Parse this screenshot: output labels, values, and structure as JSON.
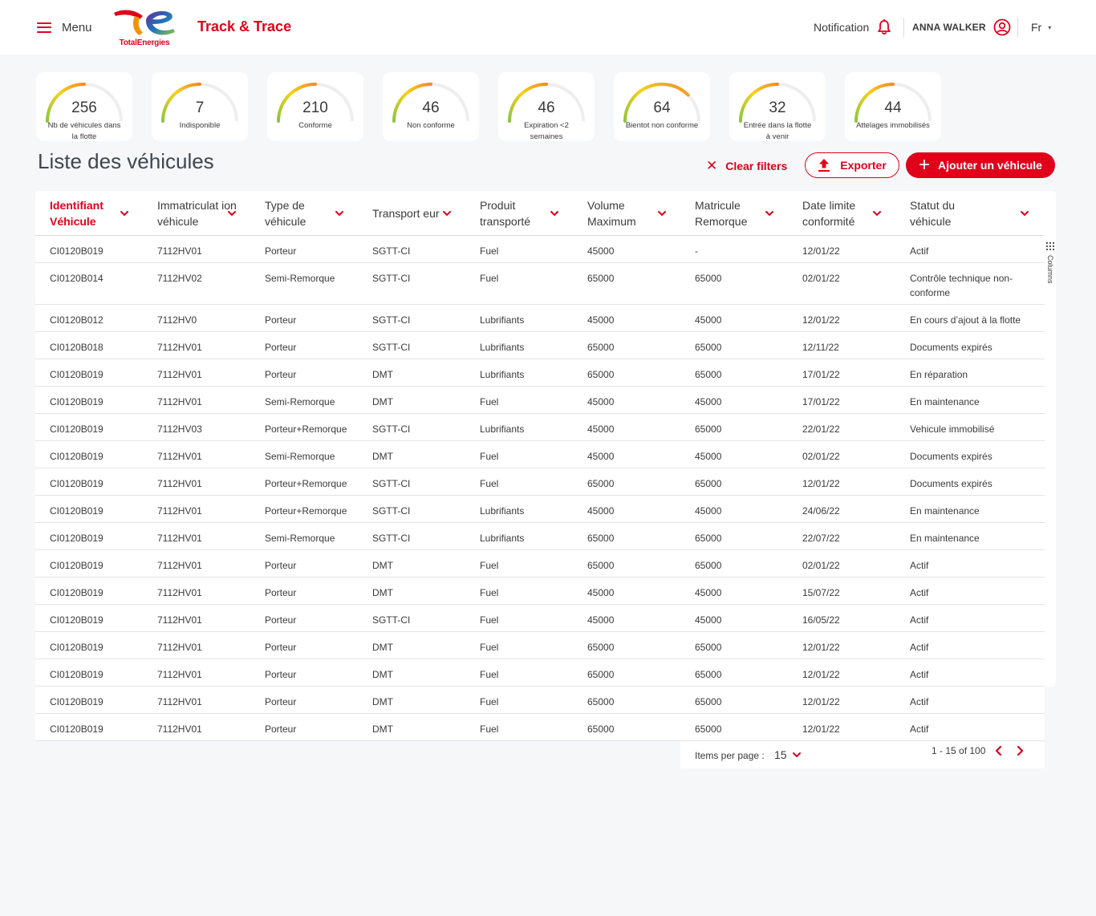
{
  "header": {
    "menu_label": "Menu",
    "logo_text": "TotalEnergies",
    "app_title": "Track & Trace",
    "notification_label": "Notification",
    "user_name": "ANNA WALKER",
    "language": "Fr"
  },
  "colors": {
    "accent": "#e0001a",
    "gauge_start": "#8cc63f",
    "gauge_mid": "#f7d117",
    "gauge_end": "#f28c28"
  },
  "kpis": [
    {
      "value": "256",
      "label": "Nb de véhicules dans la flotte",
      "level": 0.5
    },
    {
      "value": "7",
      "label": "Indisponible",
      "level": 0.5
    },
    {
      "value": "210",
      "label": "Conforme",
      "level": 0.5
    },
    {
      "value": "46",
      "label": "Non conforme",
      "level": 0.5
    },
    {
      "value": "46",
      "label": "Expiration <2 semaines",
      "level": 0.5
    },
    {
      "value": "64",
      "label": "Bientot non conforme",
      "level": 0.75
    },
    {
      "value": "32",
      "label": "Entrée dans la flotte à venir",
      "level": 0.5
    },
    {
      "value": "44",
      "label": "Attelages immobilisés",
      "level": 0.5
    }
  ],
  "page": {
    "title": "Liste des véhicules",
    "clear_filters": "Clear filters",
    "export_label": "Exporter",
    "add_label": "Ajouter un véhicule"
  },
  "table": {
    "columns": [
      "Identifiant Véhicule",
      "Immatriculat ion véhicule",
      "Type de véhicule",
      "Transport eur",
      "Produit transporté",
      "Volume Maximum",
      "Matricule Remorque",
      "Date limite conformité",
      "Statut du véhicule"
    ],
    "active_column": 0,
    "columns_tab_label": "Columns",
    "rows": [
      [
        "CI0120B019",
        "7112HV01",
        "Porteur",
        "SGTT-CI",
        "Fuel",
        "45000",
        "-",
        "12/01/22",
        "Actif"
      ],
      [
        "CI0120B014",
        "7112HV02",
        "Semi-Remorque",
        "SGTT-CI",
        "Fuel",
        "65000",
        "65000",
        "02/01/22",
        "Contrôle technique non-conforme"
      ],
      [
        "CI0120B012",
        "7112HV0",
        "Porteur",
        "SGTT-CI",
        "Lubrifiants",
        "45000",
        "45000",
        "12/01/22",
        "En cours d’ajout à la flotte"
      ],
      [
        "CI0120B018",
        "7112HV01",
        "Porteur",
        "SGTT-CI",
        "Lubrifiants",
        "65000",
        "65000",
        "12/11/22",
        "Documents expirés"
      ],
      [
        "CI0120B019",
        "7112HV01",
        "Porteur",
        "DMT",
        "Lubrifiants",
        "65000",
        "65000",
        "17/01/22",
        "En réparation"
      ],
      [
        "CI0120B019",
        "7112HV01",
        "Semi-Remorque",
        "DMT",
        "Fuel",
        "45000",
        "45000",
        "17/01/22",
        "En maintenance"
      ],
      [
        "CI0120B019",
        "7112HV03",
        "Porteur+Remorque",
        "SGTT-CI",
        "Lubrifiants",
        "45000",
        "65000",
        "22/01/22",
        "Vehicule immobilisé"
      ],
      [
        "CI0120B019",
        "7112HV01",
        "Semi-Remorque",
        "DMT",
        "Fuel",
        "45000",
        "45000",
        "02/01/22",
        "Documents expirés"
      ],
      [
        "CI0120B019",
        "7112HV01",
        "Porteur+Remorque",
        "SGTT-CI",
        "Fuel",
        "65000",
        "65000",
        "12/01/22",
        "Documents expirés"
      ],
      [
        "CI0120B019",
        "7112HV01",
        "Porteur+Remorque",
        "SGTT-CI",
        "Lubrifiants",
        "45000",
        "45000",
        "24/06/22",
        "En maintenance"
      ],
      [
        "CI0120B019",
        "7112HV01",
        "Semi-Remorque",
        "SGTT-CI",
        "Lubrifiants",
        "65000",
        "65000",
        "22/07/22",
        "En maintenance"
      ],
      [
        "CI0120B019",
        "7112HV01",
        "Porteur",
        "DMT",
        "Fuel",
        "65000",
        "65000",
        "02/01/22",
        "Actif"
      ],
      [
        "CI0120B019",
        "7112HV01",
        "Porteur",
        "DMT",
        "Fuel",
        "45000",
        "45000",
        "15/07/22",
        "Actif"
      ],
      [
        "CI0120B019",
        "7112HV01",
        "Porteur",
        "SGTT-CI",
        "Fuel",
        "45000",
        "45000",
        "16/05/22",
        "Actif"
      ],
      [
        "CI0120B019",
        "7112HV01",
        "Porteur",
        "DMT",
        "Fuel",
        "65000",
        "65000",
        "12/01/22",
        "Actif"
      ],
      [
        "CI0120B019",
        "7112HV01",
        "Porteur",
        "DMT",
        "Fuel",
        "65000",
        "65000",
        "12/01/22",
        "Actif"
      ],
      [
        "CI0120B019",
        "7112HV01",
        "Porteur",
        "DMT",
        "Fuel",
        "65000",
        "65000",
        "12/01/22",
        "Actif"
      ],
      [
        "CI0120B019",
        "7112HV01",
        "Porteur",
        "DMT",
        "Fuel",
        "65000",
        "65000",
        "12/01/22",
        "Actif"
      ]
    ]
  },
  "pagination": {
    "items_per_page_label": "Items per page :",
    "items_per_page": "15",
    "range": "1 - 15 of 100"
  }
}
